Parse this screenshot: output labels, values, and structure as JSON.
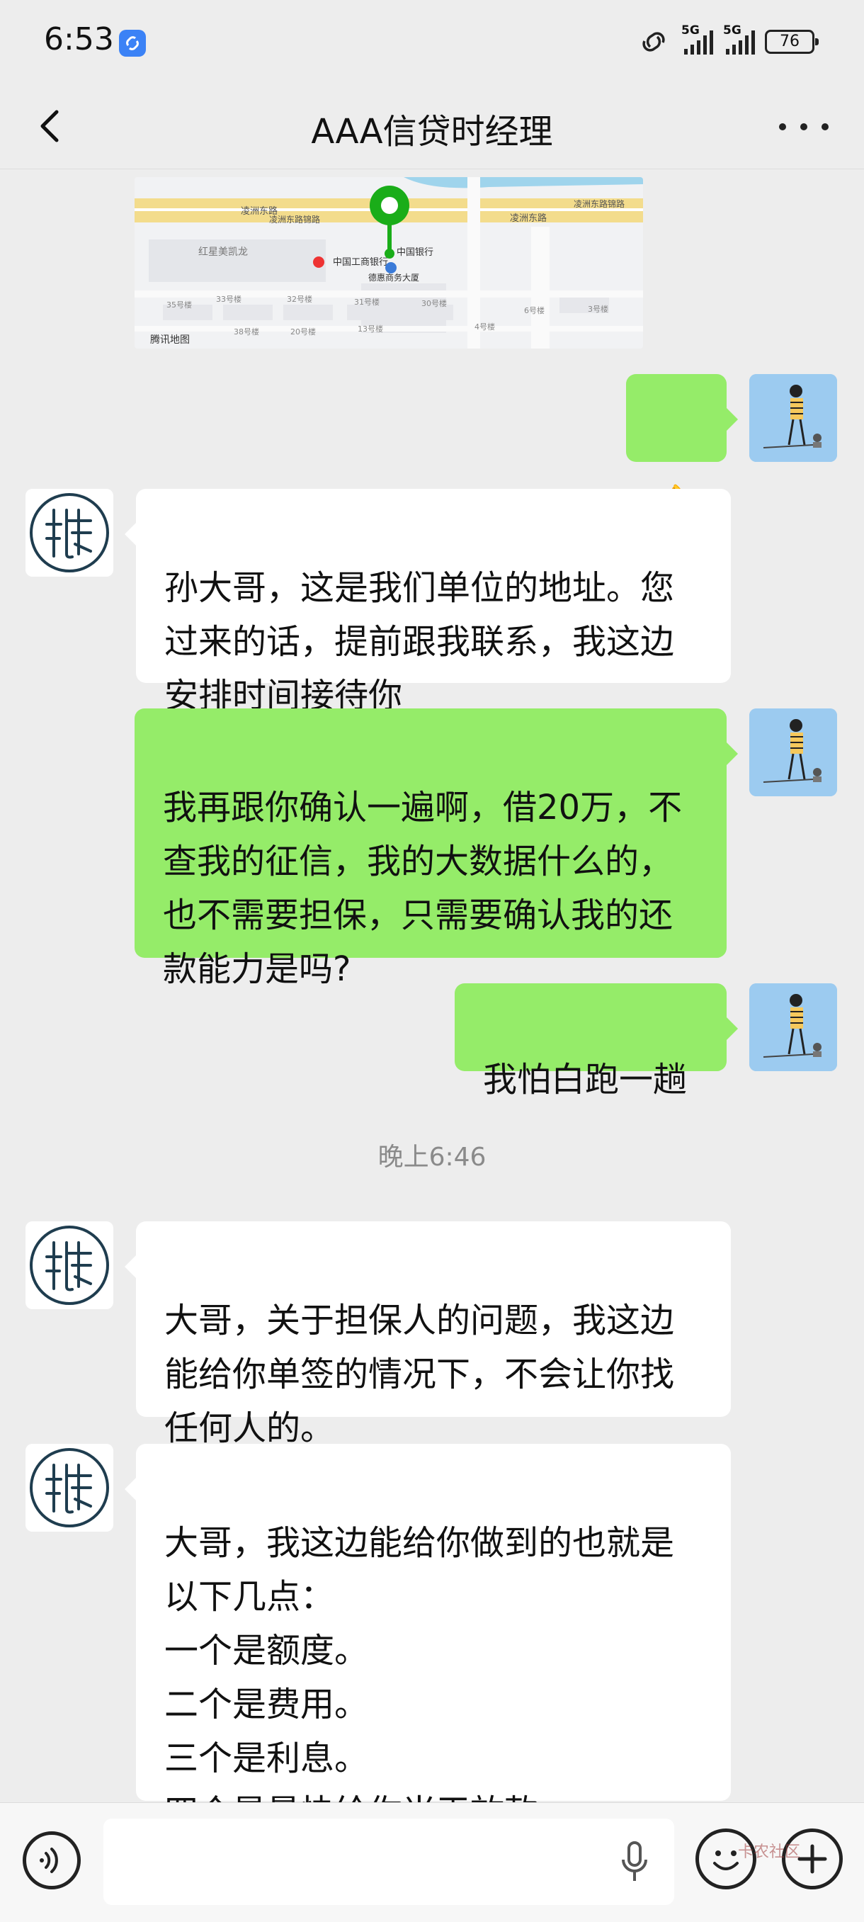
{
  "status_bar": {
    "time": "6:53",
    "network1": "5G",
    "network2": "5G",
    "battery": "76"
  },
  "header": {
    "title": "AAA信贷时经理"
  },
  "map": {
    "labels": [
      "凌洲东路",
      "凌洲东路锦路",
      "凌洲东路",
      "凌洲东路锦路",
      "红星美凯龙",
      "中国银行",
      "中国工商银行",
      "德惠商务大厦",
      "33号楼",
      "32号楼",
      "31号楼",
      "30号楼",
      "35号楼",
      "38号楼",
      "20号楼",
      "13号楼",
      "6号楼",
      "3号楼",
      "4号楼"
    ],
    "attribution": "腾讯地图"
  },
  "messages": [
    {
      "side": "right",
      "text": "👌"
    },
    {
      "side": "left",
      "text": "孙大哥，这是我们单位的地址。您过来的话，提前跟我联系，我这边安排时间接待你"
    },
    {
      "side": "right",
      "text": "我再跟你确认一遍啊，借20万，不查我的征信，我的大数据什么的，也不需要担保，只需要确认我的还款能力是吗?"
    },
    {
      "side": "right",
      "text": "我怕白跑一趟"
    },
    {
      "side": "left",
      "text": "大哥，关于担保人的问题，我这边能给你单签的情况下，不会让你找任何人的。"
    },
    {
      "side": "left",
      "text": "大哥，我这边能给你做到的也就是以下几点：\n一个是额度。\n二个是费用。\n三个是利息。\n四个是最快给你当天放款。"
    }
  ],
  "timestamp": "晚上6:46",
  "watermark": "卡农社区",
  "colors": {
    "background": "#ededed",
    "bubble_self": "#95ec69",
    "bubble_other": "#ffffff",
    "map_pin": "#1aad19"
  }
}
